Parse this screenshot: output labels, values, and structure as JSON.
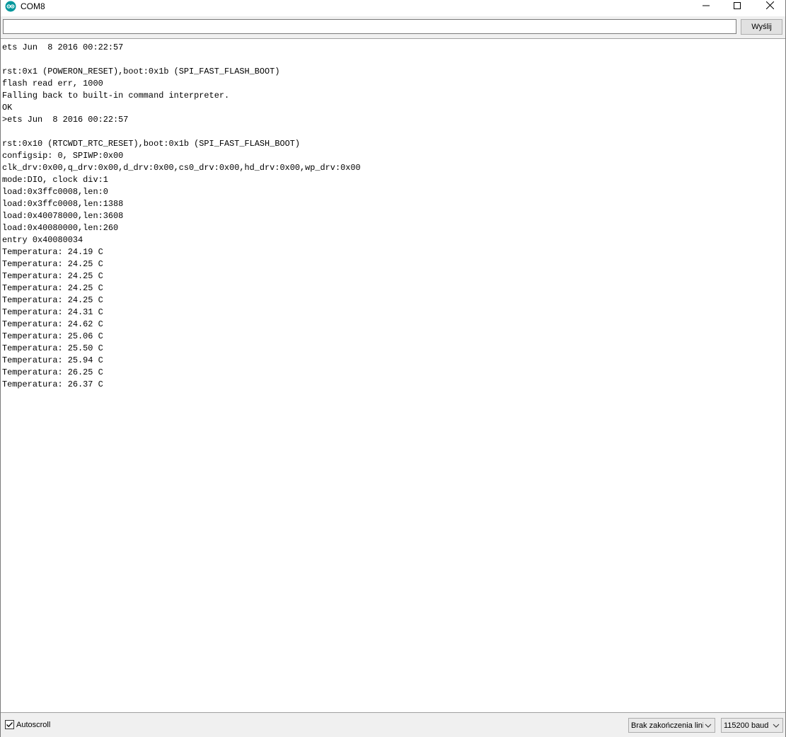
{
  "window": {
    "title": "COM8",
    "icon": "arduino-icon",
    "controls": [
      "minimize-icon",
      "maximize-icon",
      "close-icon"
    ]
  },
  "send": {
    "input_value": "",
    "button_label": "Wyślij"
  },
  "output": {
    "lines": [
      "ets Jun  8 2016 00:22:57",
      "",
      "rst:0x1 (POWERON_RESET),boot:0x1b (SPI_FAST_FLASH_BOOT)",
      "flash read err, 1000",
      "Falling back to built-in command interpreter.",
      "OK",
      ">ets Jun  8 2016 00:22:57",
      "",
      "rst:0x10 (RTCWDT_RTC_RESET),boot:0x1b (SPI_FAST_FLASH_BOOT)",
      "configsip: 0, SPIWP:0x00",
      "clk_drv:0x00,q_drv:0x00,d_drv:0x00,cs0_drv:0x00,hd_drv:0x00,wp_drv:0x00",
      "mode:DIO, clock div:1",
      "load:0x3ffc0008,len:0",
      "load:0x3ffc0008,len:1388",
      "load:0x40078000,len:3608",
      "load:0x40080000,len:260",
      "entry 0x40080034",
      "Temperatura: 24.19 C",
      "Temperatura: 24.25 C",
      "Temperatura: 24.25 C",
      "Temperatura: 24.25 C",
      "Temperatura: 24.25 C",
      "Temperatura: 24.31 C",
      "Temperatura: 24.62 C",
      "Temperatura: 25.06 C",
      "Temperatura: 25.50 C",
      "Temperatura: 25.94 C",
      "Temperatura: 26.25 C",
      "Temperatura: 26.37 C"
    ]
  },
  "bottom": {
    "autoscroll_label": "Autoscroll",
    "autoscroll_checked": true,
    "line_ending": "Brak zakończenia lini",
    "baud_rate": "115200 baud"
  },
  "colors": {
    "arduino_teal": "#00979c",
    "window_bg": "#f0f0f0",
    "text": "#000000"
  }
}
